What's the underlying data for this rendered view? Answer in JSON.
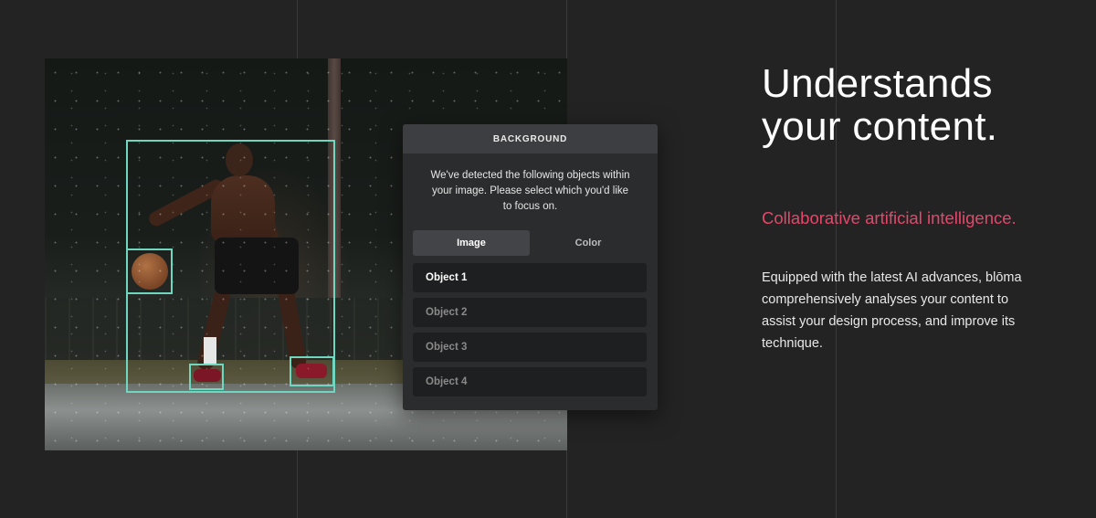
{
  "panel": {
    "title": "BACKGROUND",
    "description": "We've detected the following objects within your image. Please select which you'd like to focus on.",
    "tabs": [
      {
        "label": "Image",
        "active": true
      },
      {
        "label": "Color",
        "active": false
      }
    ],
    "objects": [
      {
        "label": "Object 1",
        "selected": true
      },
      {
        "label": "Object 2",
        "selected": false
      },
      {
        "label": "Object 3",
        "selected": false
      },
      {
        "label": "Object 4",
        "selected": false
      }
    ]
  },
  "hero": {
    "headline": "Understands your content.",
    "subheadline": "Collaborative artificial intelligence.",
    "body": "Equipped with the latest AI advances, blōma comprehensively analyses your content to assist your design process, and improve its technique."
  },
  "colors": {
    "background": "#232323",
    "detection_box": "#6fd6bf",
    "accent": "#e5476a"
  }
}
